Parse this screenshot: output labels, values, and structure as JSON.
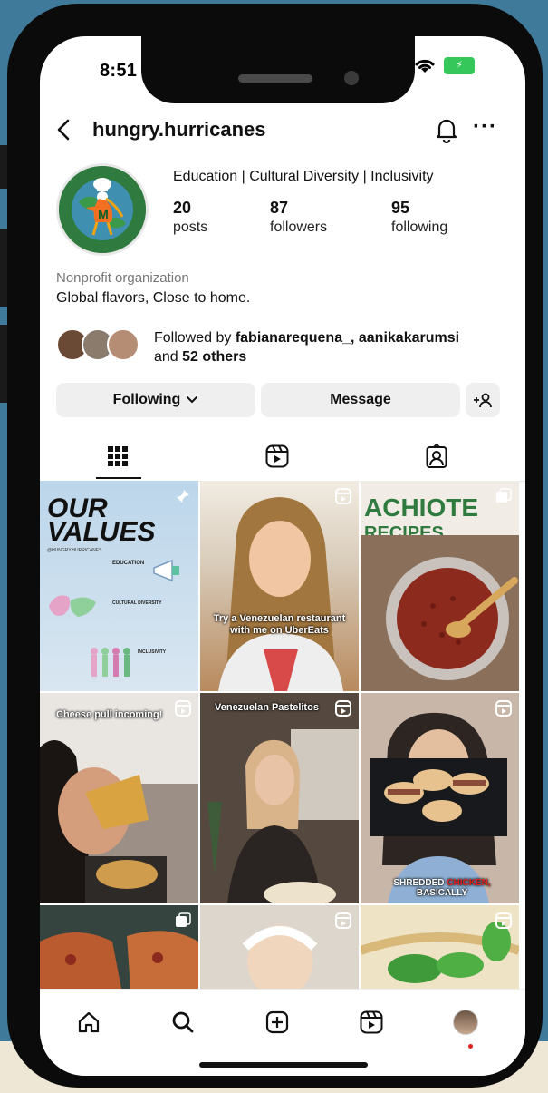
{
  "status_bar": {
    "time": "8:51"
  },
  "header": {
    "username": "hungry.hurricanes"
  },
  "profile": {
    "tagline": "Education | Cultural Diversity | Inclusivity",
    "stats": [
      {
        "value": "20",
        "label": "posts"
      },
      {
        "value": "87",
        "label": "followers"
      },
      {
        "value": "95",
        "label": "following"
      }
    ],
    "category": "Nonprofit organization",
    "bio": "Global flavors, Close to home.",
    "followed_by_prefix": "Followed by",
    "followed_by_names": "fabianarequena_, aanikakarumsi",
    "followed_by_and": "and",
    "followed_by_others": "52 others"
  },
  "actions": {
    "following": "Following",
    "message": "Message"
  },
  "grid": {
    "post1": {
      "title_line1": "OUR",
      "title_line2": "VALUES",
      "handle": "@HUNGRY.HURRICANES",
      "section1": "EDUCATION",
      "section2": "CULTURAL DIVERSITY",
      "section3": "INCLUSIVITY"
    },
    "post2_caption": "Try a Venezuelan restaurant with me on UberEats",
    "post3_line1": "ACHIOTE",
    "post3_line2": "RECIPES",
    "post4_caption": "Cheese pull incoming!",
    "post5_caption": "Venezuelan Pastelitos",
    "post6_caption_a": "SHREDDED",
    "post6_caption_b": "CHICKEN,",
    "post6_caption_c": "BASICALLY"
  },
  "colors": {
    "accent_red": "#e0231f",
    "battery_green": "#35c759",
    "achiote_green": "#2f7a3e"
  }
}
